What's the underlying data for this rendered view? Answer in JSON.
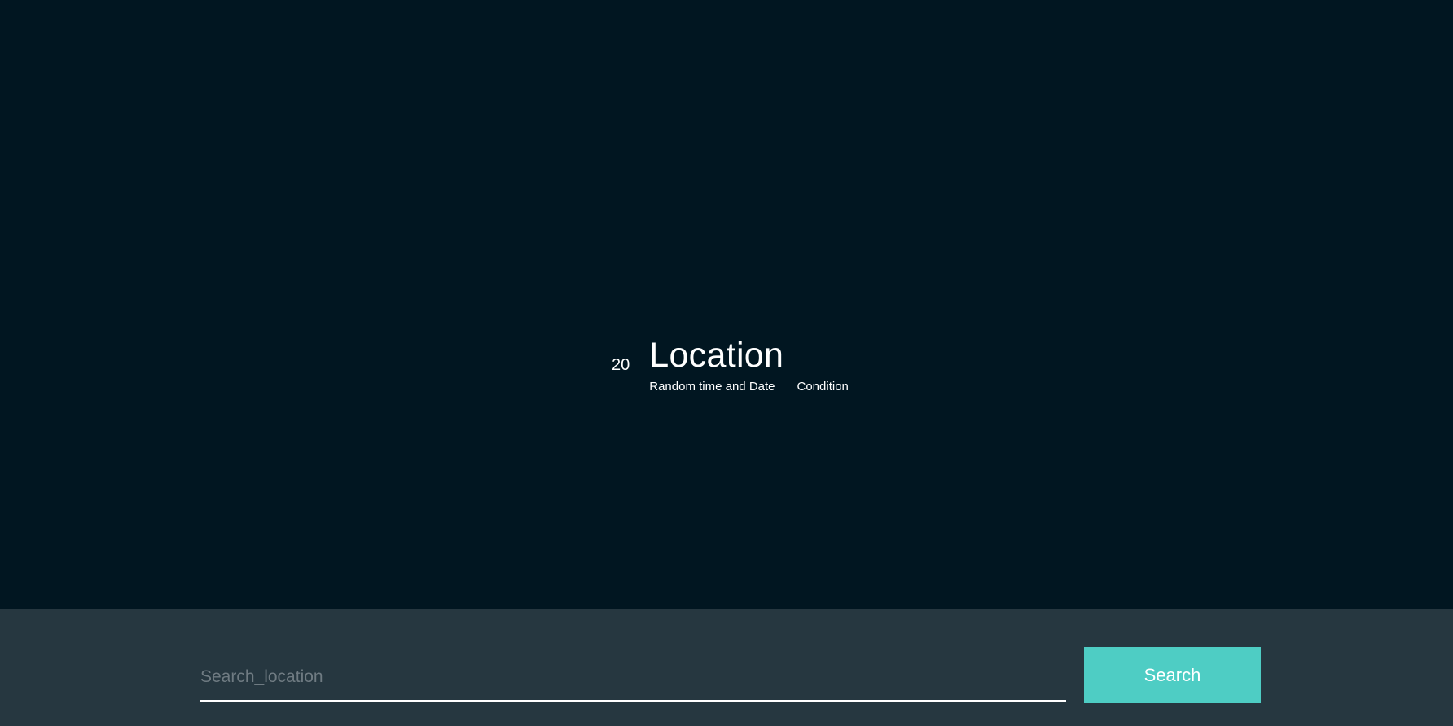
{
  "weather": {
    "temperature": "20",
    "location": "Location",
    "datetime": "Random time and Date",
    "condition": "Condition"
  },
  "search": {
    "placeholder": "Search_location",
    "value": "",
    "button_label": "Search"
  },
  "colors": {
    "background": "#011621",
    "search_bar": "#263740",
    "accent": "#4ecdc4",
    "text": "#ffffff",
    "placeholder": "#6f7b82"
  }
}
